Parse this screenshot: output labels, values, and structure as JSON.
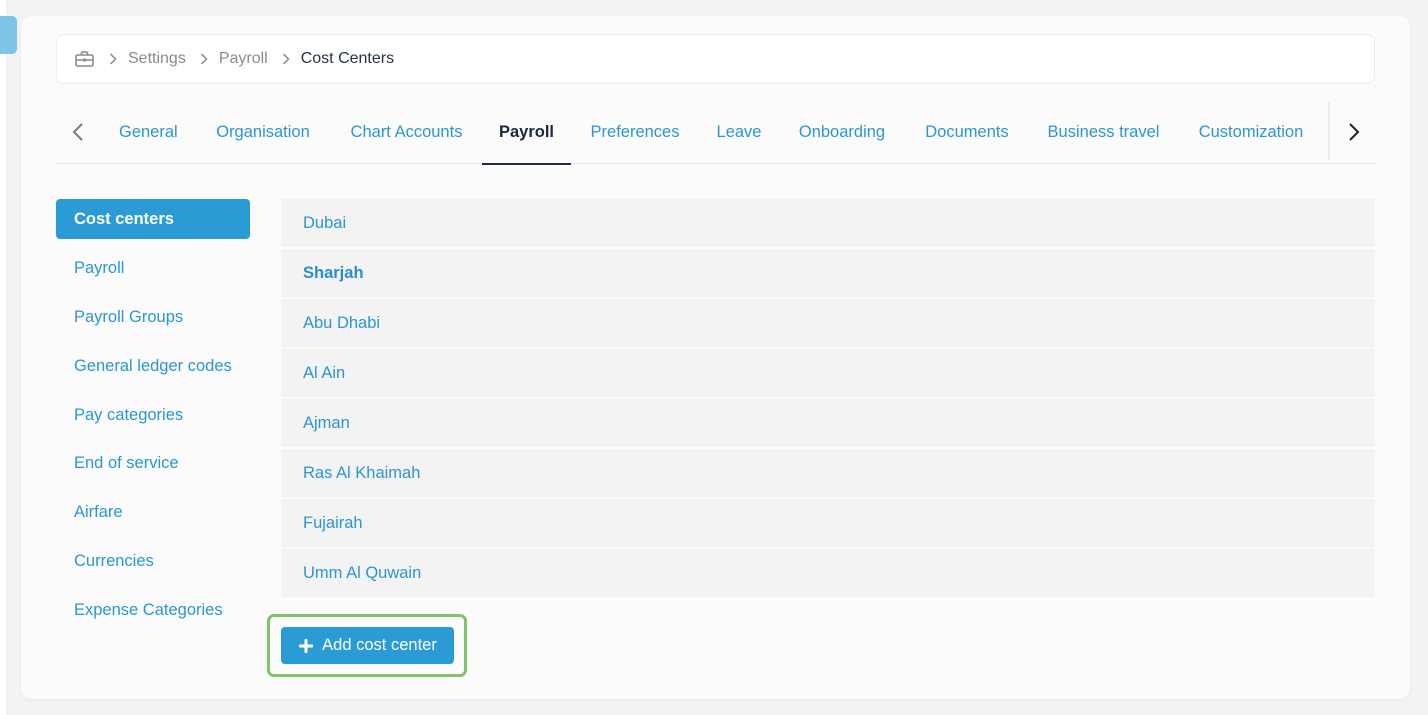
{
  "breadcrumb": {
    "home_icon": "briefcase-icon",
    "items": [
      "Settings",
      "Payroll",
      "Cost Centers"
    ]
  },
  "tabs": {
    "items": [
      {
        "label": "General"
      },
      {
        "label": "Organisation"
      },
      {
        "label": "Chart Accounts"
      },
      {
        "label": "Payroll"
      },
      {
        "label": "Preferences"
      },
      {
        "label": "Leave"
      },
      {
        "label": "Onboarding"
      },
      {
        "label": "Documents"
      },
      {
        "label": "Business travel"
      },
      {
        "label": "Customization"
      }
    ],
    "active": "Payroll"
  },
  "subnav": {
    "items": [
      {
        "label": "Cost centers"
      },
      {
        "label": "Payroll"
      },
      {
        "label": "Payroll Groups"
      },
      {
        "label": "General ledger codes"
      },
      {
        "label": "Pay categories"
      },
      {
        "label": "End of service"
      },
      {
        "label": "Airfare"
      },
      {
        "label": "Currencies"
      },
      {
        "label": "Expense Categories"
      }
    ],
    "active": "Cost centers"
  },
  "cost_centers": {
    "rows": [
      {
        "name": "Dubai"
      },
      {
        "name": "Sharjah"
      },
      {
        "name": "Abu Dhabi"
      },
      {
        "name": "Al Ain"
      },
      {
        "name": "Ajman"
      },
      {
        "name": "Ras Al Khaimah"
      },
      {
        "name": "Fujairah"
      },
      {
        "name": "Umm Al Quwain"
      }
    ]
  },
  "actions": {
    "add_label": "Add cost center"
  },
  "colors": {
    "accent": "#2b9bd6",
    "link": "#2b96d1",
    "active_tab_text": "#1c2740",
    "highlight": "#7dc46a"
  }
}
